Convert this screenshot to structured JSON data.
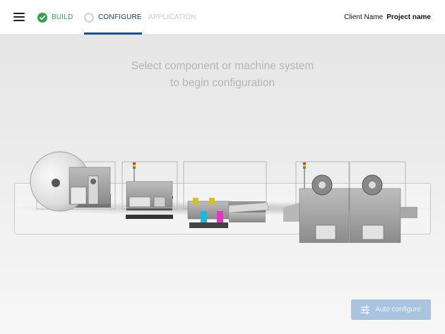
{
  "header": {
    "menu_icon": "hamburger-menu-icon",
    "steps": [
      {
        "label": "BUILD",
        "state": "complete",
        "icon": "check-circle-icon",
        "color": "#2fa64a"
      },
      {
        "label": "CONFIGURE",
        "state": "active",
        "icon": "radio-circle-icon",
        "color": "#1e4f9b"
      },
      {
        "label": "APPLICATION",
        "state": "disabled",
        "color": "#c8ccd2"
      }
    ],
    "client_label": "Client Name",
    "project_label": "Project name"
  },
  "main": {
    "prompt_line1": "Select component or machine system",
    "prompt_line2": "to begin configuration",
    "components": [
      {
        "name": "unwinder-module"
      },
      {
        "name": "web-guide-module"
      },
      {
        "name": "print-station-module"
      },
      {
        "name": "conveyor-module"
      },
      {
        "name": "laminator-module"
      },
      {
        "name": "rewinder-module"
      }
    ],
    "auto_configure_label": "Auto configure",
    "auto_configure_icon": "tune-sliders-icon",
    "colors": {
      "accent": "#1e4f9b",
      "success": "#2fa64a",
      "button_disabled": "#a9c4de",
      "ink_cyan": "#19b9e0",
      "ink_magenta": "#e535c8",
      "ink_yellow": "#d8c020"
    }
  }
}
